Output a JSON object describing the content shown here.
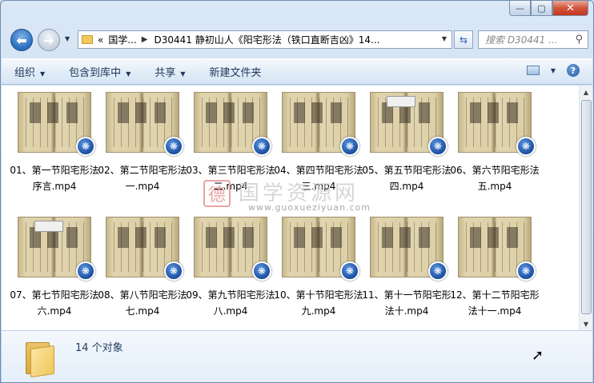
{
  "window": {
    "caption_buttons": {
      "minimize": "—",
      "maximize": "▢",
      "close": "✕"
    }
  },
  "nav": {
    "back_glyph": "⬅",
    "forward_glyph": "➜",
    "address": {
      "overflow": "«",
      "crumbs": [
        "国学...",
        "D30441 静初山人《阳宅形法（铁口直断吉凶》14..."
      ]
    },
    "search_placeholder": "搜索 D30441 ..."
  },
  "toolbar": {
    "organize": "组织",
    "include_in_library": "包含到库中",
    "share": "共享",
    "new_folder": "新建文件夹"
  },
  "files": [
    {
      "name": "01、第一节阳宅形法序言.mp4"
    },
    {
      "name": "02、第二节阳宅形法一.mp4"
    },
    {
      "name": "03、第三节阳宅形法二.mp4"
    },
    {
      "name": "04、第四节阳宅形法三.mp4"
    },
    {
      "name": "05、第五节阳宅形法四.mp4"
    },
    {
      "name": "06、第六节阳宅形法五.mp4"
    },
    {
      "name": "07、第七节阳宅形法六.mp4"
    },
    {
      "name": "08、第八节阳宅形法七.mp4"
    },
    {
      "name": "09、第九节阳宅形法八.mp4"
    },
    {
      "name": "10、第十节阳宅形法九.mp4"
    },
    {
      "name": "11、第十一节阳宅形法十.mp4"
    },
    {
      "name": "12、第十二节阳宅形法十一.mp4"
    }
  ],
  "watermark": {
    "seal": "德",
    "text": "国学资源网",
    "url": "www.guoxueziyuan.com"
  },
  "details": {
    "count": "14 个对象"
  }
}
